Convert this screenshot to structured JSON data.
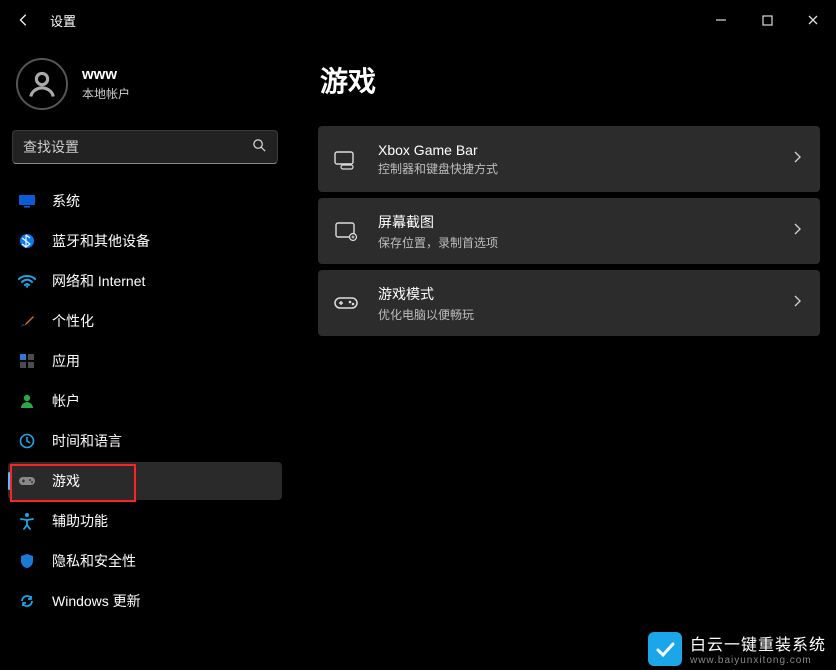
{
  "titlebar": {
    "app_title": "设置"
  },
  "user": {
    "name": "www",
    "account_type": "本地帐户"
  },
  "search": {
    "placeholder": "查找设置"
  },
  "nav": {
    "items": [
      {
        "label": "系统"
      },
      {
        "label": "蓝牙和其他设备"
      },
      {
        "label": "网络和 Internet"
      },
      {
        "label": "个性化"
      },
      {
        "label": "应用"
      },
      {
        "label": "帐户"
      },
      {
        "label": "时间和语言"
      },
      {
        "label": "游戏"
      },
      {
        "label": "辅助功能"
      },
      {
        "label": "隐私和安全性"
      },
      {
        "label": "Windows 更新"
      }
    ],
    "active_index": 7
  },
  "page": {
    "title": "游戏",
    "cards": [
      {
        "title": "Xbox Game Bar",
        "sub": "控制器和键盘快捷方式"
      },
      {
        "title": "屏幕截图",
        "sub": "保存位置，录制首选项"
      },
      {
        "title": "游戏模式",
        "sub": "优化电脑以便畅玩"
      }
    ]
  },
  "watermark": {
    "line1": "白云一键重装系统",
    "line2": "www.baiyunxitong.com"
  }
}
